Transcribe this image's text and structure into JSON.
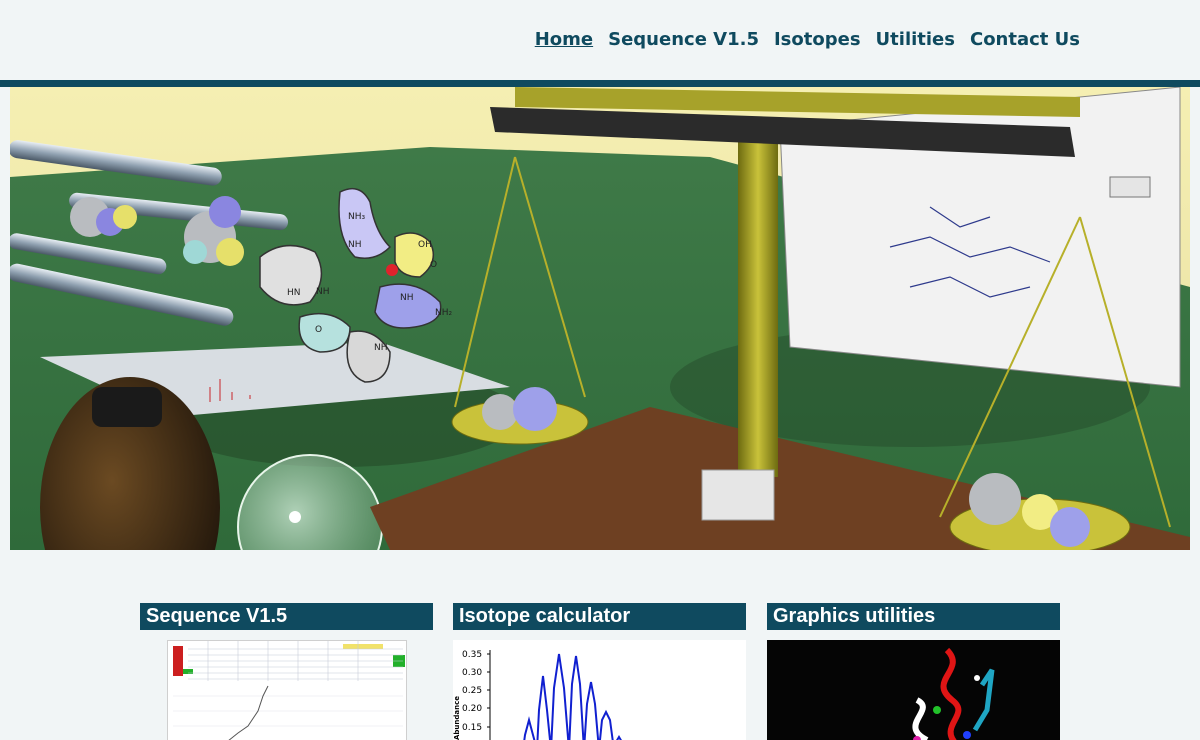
{
  "nav": {
    "items": [
      {
        "label": "Home",
        "active": true
      },
      {
        "label": "Sequence V1.5",
        "active": false
      },
      {
        "label": "Isotopes",
        "active": false
      },
      {
        "label": "Utilities",
        "active": false
      },
      {
        "label": "Contact Us",
        "active": false
      }
    ]
  },
  "colors": {
    "accent": "#0f4a5f",
    "background": "#f1f5f6"
  },
  "cards": [
    {
      "title": "Sequence V1.5"
    },
    {
      "title": "Isotope calculator"
    },
    {
      "title": "Graphics utilities"
    }
  ],
  "isotope_plot": {
    "ylabel": "Abundance",
    "yticks": [
      "0.35",
      "0.30",
      "0.25",
      "0.20",
      "0.15"
    ]
  },
  "molecule_labels": {
    "nh3": "NH₃",
    "oh": "OH",
    "o1": "O",
    "o2": "O",
    "nh1": "NH",
    "nh2": "NH",
    "nh3b": "NH",
    "nh4": "NH",
    "hn": "HN",
    "nh2b": "NH₂"
  }
}
